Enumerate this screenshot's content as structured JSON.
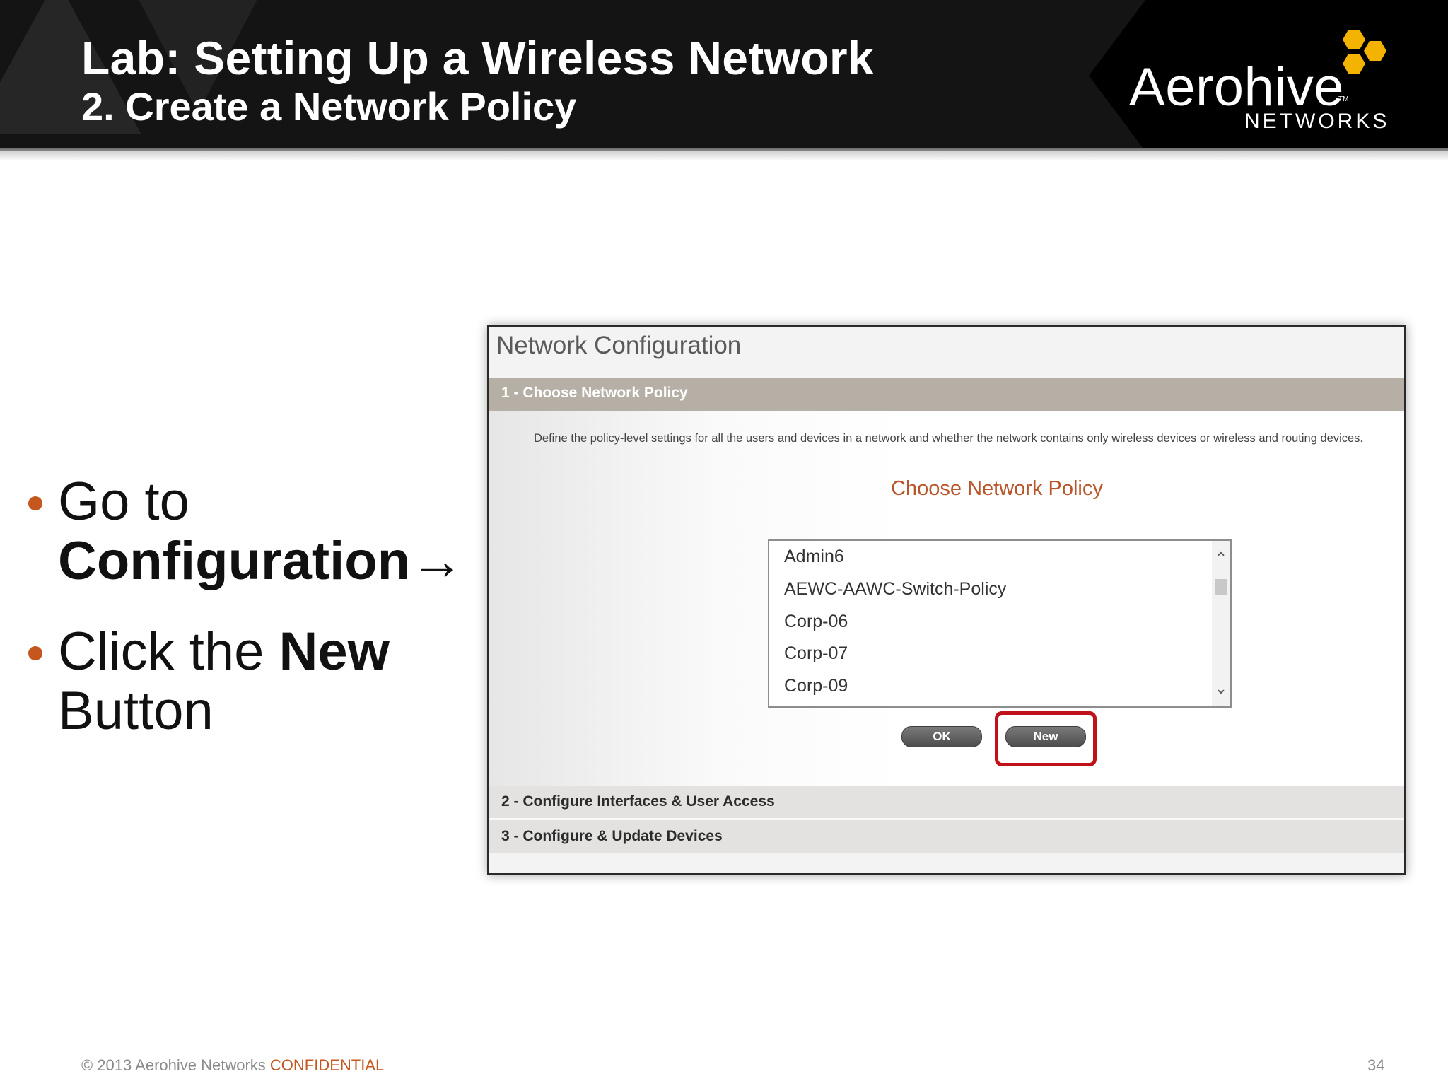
{
  "slide": {
    "title": "Lab: Setting Up a Wireless Network",
    "subtitle": "2. Create a Network Policy"
  },
  "logo": {
    "wordmark": "Aerohive",
    "subtext": "NETWORKS",
    "trademark": "TM",
    "hex_color": "#f5b301"
  },
  "bullets": {
    "b1_plain": "Go to",
    "b1_bold": "Configuration→",
    "b2_plain": "Click the",
    "b2_bold": "New",
    "b2_tail": "Button"
  },
  "screenshot": {
    "panel_title": "Network Configuration",
    "step1_label": "1 - Choose Network Policy",
    "description": "Define the policy-level settings for all the users and devices in a network and whether the network contains only wireless devices or wireless and routing devices.",
    "choose_heading": "Choose Network Policy",
    "policies": [
      "Admin6",
      "AEWC-AAWC-Switch-Policy",
      "Corp-06",
      "Corp-07",
      "Corp-09"
    ],
    "ok_label": "OK",
    "new_label": "New",
    "step2_label": "2 - Configure Interfaces & User Access",
    "step3_label": "3 - Configure & Update Devices"
  },
  "footer": {
    "copyright": "© 2013 Aerohive Networks",
    "confidential": "CONFIDENTIAL",
    "page_number": "34"
  },
  "colors": {
    "accent_orange": "#c4561e",
    "highlight_red": "#c0101a",
    "header_bg": "#141414"
  }
}
